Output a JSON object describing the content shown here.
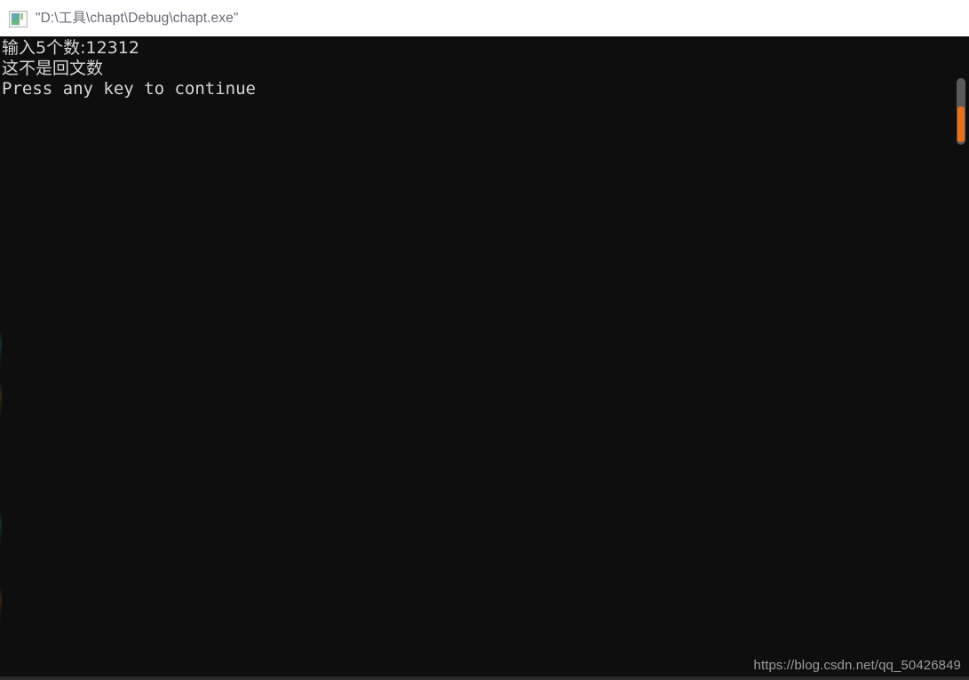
{
  "window": {
    "title": "\"D:\\工具\\chapt\\Debug\\chapt.exe\"",
    "icon_name": "console-app-icon",
    "titlebar_bg": "#ffffff",
    "titlebar_text_color": "#6a6a78"
  },
  "console": {
    "background": "#0e0e0e",
    "text_color": "#d6d6d6",
    "lines": [
      "输入5个数:12312",
      "这不是回文数",
      "Press any key to continue"
    ]
  },
  "scrollbar": {
    "track_color": "#5a5a5a",
    "thumb_color": "#e8701a",
    "orientation": "vertical"
  },
  "watermark": {
    "text": "https://blog.csdn.net/qq_50426849",
    "color": "#9c9c9c"
  }
}
